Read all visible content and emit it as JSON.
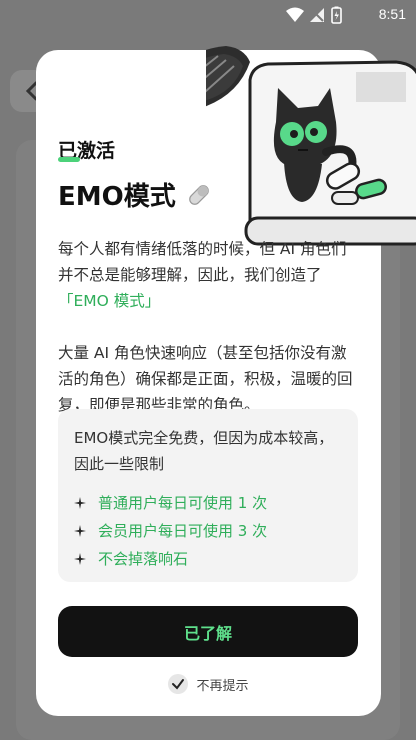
{
  "status_bar": {
    "time": "8:51",
    "icons": [
      "wifi-icon",
      "signal-icon",
      "battery-icon"
    ]
  },
  "modal": {
    "status_label": "已激活",
    "title": "EMO模式",
    "description_1_a": "每个人都有情绪低落的时候，但 AI 角色们并不总是能够理解，因此，我们创造了",
    "description_1_highlight": "「EMO 模式」",
    "description_2": "大量 AI 角色快速响应（甚至包括你没有激活的角色）确保都是正面，积极，温暖的回复，即便是那些非常的角色。",
    "limits": {
      "intro": "EMO模式完全免费，但因为成本较高，因此一些限制",
      "items": [
        "普通用户每日可使用 1 次",
        "会员用户每日可使用 3 次",
        "不会掉落响石"
      ]
    },
    "confirm_button": "已了解",
    "dont_show_again": "不再提示",
    "dont_show_checked": true
  },
  "colors": {
    "accent_green": "#2fae5a",
    "button_bg": "#121212",
    "button_text": "#5fe08c"
  }
}
